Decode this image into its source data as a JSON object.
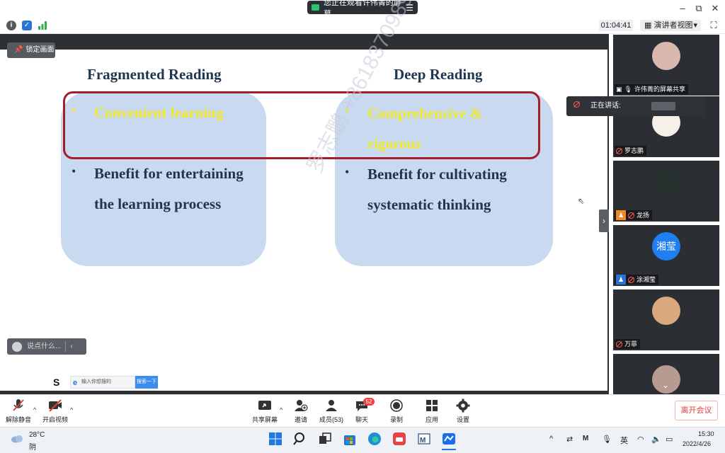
{
  "titlebar": {
    "watching_label": "您正在观看许伟菁的屏幕",
    "menu_icon": "menu-lines-icon",
    "minimize": "–",
    "restore": "⧉",
    "close": "✕"
  },
  "toolbar": {
    "timer": "01:04:41",
    "view_label": "演讲者视图",
    "view_caret": "▾",
    "fullscreen": "⛶"
  },
  "stage": {
    "lock_label": "锁定画面",
    "slide": {
      "left_title": "Fragmented Reading",
      "right_title": "Deep Reading",
      "left_bullets": [
        {
          "line1": "Convenient learning",
          "line2": ""
        },
        {
          "line1": "Benefit for entertaining",
          "line2": "the learning process"
        }
      ],
      "right_bullets": [
        {
          "line1": "Comprehensive &",
          "line2": "rigorous"
        },
        {
          "line1": "Benefit for cultivating",
          "line2": "systematic thinking"
        }
      ],
      "bullet_char": "•"
    },
    "watermark": "罗志鹏 +8618370989865",
    "chat_placeholder": "说点什么...",
    "chat_chevron": "‹",
    "search_placeholder": "输入你想搜的",
    "search_button": "搜索一下"
  },
  "sidebar": {
    "speaking_label": "正在讲话:",
    "participants": [
      {
        "name": "许伟菁的屏幕共享",
        "avatar_color": "#d9b8b0"
      },
      {
        "name": "罗志鹏",
        "avatar_color": "#f5f1e8"
      },
      {
        "name": "龙扬",
        "avatar_color": "#25302e"
      },
      {
        "name": "涂湘莹",
        "avatar_text": "湘莹",
        "avatar_color": "#1f7ef0"
      },
      {
        "name": "万菲",
        "avatar_color": "#d9a87c"
      },
      {
        "name": "",
        "avatar_color": "#b79a90"
      }
    ],
    "collapse_chevron": "›",
    "scroll_chevron": "⌄"
  },
  "controls": {
    "unmute": "解除静音",
    "start_video": "开启视频",
    "share_screen": "共享屏幕",
    "invite": "邀请",
    "members": "成员(53)",
    "chat": "聊天",
    "chat_badge": "52",
    "record": "录制",
    "apps": "应用",
    "settings": "设置",
    "leave": "离开会议",
    "caret": "^"
  },
  "taskbar": {
    "temperature": "28°C",
    "weather": "阴",
    "ime": "英",
    "time": "15:30",
    "date": "2022/4/26",
    "tray_caret": "^"
  },
  "colors": {
    "slide_navy": "#1f3550",
    "slide_yellow": "#f0e82a",
    "card_blue": "#c9d9f0",
    "highlight_red": "#a51c2a",
    "leave_red": "#e53b3b"
  }
}
